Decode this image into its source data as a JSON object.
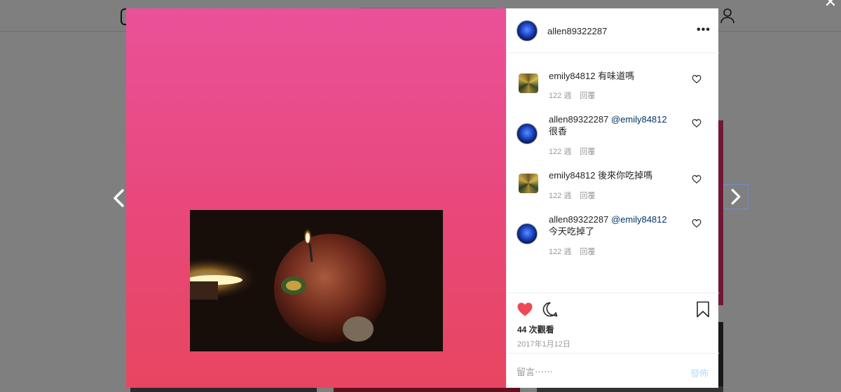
{
  "post": {
    "author": "allen89322287",
    "views_text": "44 次觀看",
    "date": "2017年1月12日"
  },
  "comments": [
    {
      "user": "emily84812",
      "mention": "",
      "text": "有味道嗎",
      "age": "122 週",
      "reply_label": "回覆",
      "avatar": "gold-avatar"
    },
    {
      "user": "allen89322287",
      "mention": "@emily84812",
      "text": "很香",
      "age": "122 週",
      "reply_label": "回覆",
      "avatar": "blue-avatar"
    },
    {
      "user": "emily84812",
      "mention": "",
      "text": "後來你吃掉嗎",
      "age": "122 週",
      "reply_label": "回覆",
      "avatar": "gold-avatar"
    },
    {
      "user": "allen89322287",
      "mention": "@emily84812",
      "text": "今天吃掉了",
      "age": "122 週",
      "reply_label": "回覆",
      "avatar": "blue-avatar"
    }
  ],
  "comment_input": {
    "placeholder": "留言⋯⋯",
    "value": ""
  },
  "post_button": "發佈",
  "icons": {
    "close": "close-icon",
    "prev": "chevron-left-icon",
    "next": "chevron-right-icon",
    "more": "more-horizontal-icon",
    "like": "heart-filled-icon",
    "comment": "comment-bubble-icon",
    "save": "bookmark-icon"
  },
  "colors": {
    "like": "#ed4956",
    "mention": "#003569",
    "post_disabled": "#b3dbff"
  }
}
